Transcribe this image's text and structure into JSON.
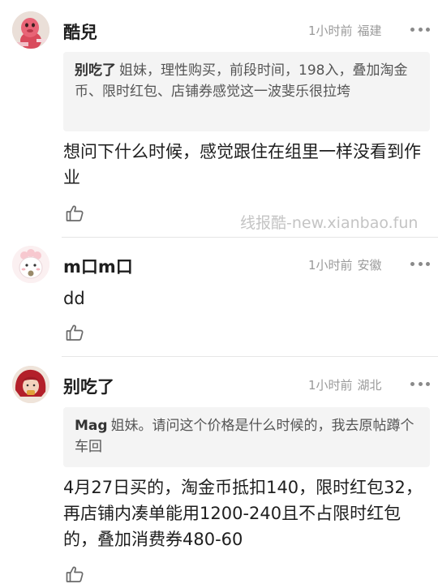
{
  "comments": [
    {
      "username": "酷兒",
      "time": "1小时前",
      "location": "福建",
      "quote": {
        "name": "别吃了",
        "text": "姐妹，理性购买，前段时间，198入，叠加淘金币、限时红包、店铺券感觉这一波斐乐很拉垮"
      },
      "body": "想问下什么时候，感觉跟住在组里一样没看到作业",
      "avatar_icon": "pink-cartoon-avatar-icon"
    },
    {
      "username": "m口m口",
      "time": "1小时前",
      "location": "安徽",
      "body": "dd",
      "avatar_icon": "white-cartoon-avatar-icon"
    },
    {
      "username": "别吃了",
      "time": "1小时前",
      "location": "湖北",
      "quote": {
        "name": "Mag",
        "text": "姐妹。请问这个价格是什么时候的，我去原帖蹲个车回"
      },
      "body": "4月27日买的，淘金币抵扣140，限时红包32，再店铺内凑单能用1200-240且不占限时红包的，叠加消费券480-60",
      "avatar_icon": "red-hair-avatar-icon"
    }
  ],
  "watermark": "线报酷-new.xianbao.fun",
  "colors": {
    "meta_text": "#9a9a9a",
    "quote_bg": "#f4f4f4",
    "divider": "#e6e6e6"
  }
}
